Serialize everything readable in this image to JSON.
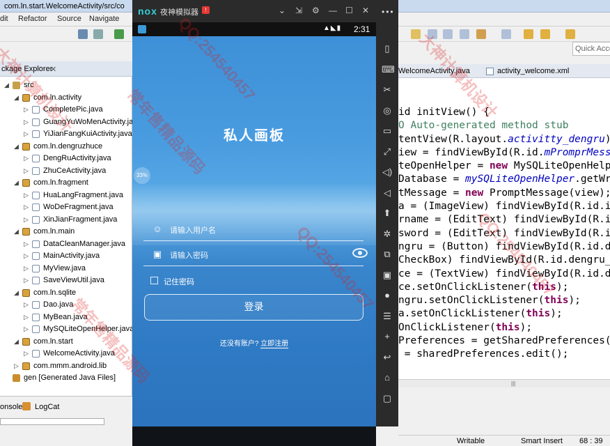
{
  "ide": {
    "title": "com.ln.start.WelcomeActivity/src/co",
    "menu": [
      "dit",
      "Refactor",
      "Source",
      "Navigate"
    ],
    "quick_access": "Quick Acce",
    "package_explorer_tab": "ckage Explorer",
    "tree": [
      {
        "label": "src",
        "type": "src",
        "level": 0,
        "arrow": "◢"
      },
      {
        "label": "com.ln.activity",
        "type": "pkg",
        "level": 1,
        "arrow": "◢"
      },
      {
        "label": "CompletePic.java",
        "type": "java",
        "level": 2,
        "arrow": "▷"
      },
      {
        "label": "GuangYuWoMenActivity.ja",
        "type": "java",
        "level": 2,
        "arrow": "▷"
      },
      {
        "label": "YiJianFangKuiActivity.java",
        "type": "java",
        "level": 2,
        "arrow": "▷"
      },
      {
        "label": "com.ln.dengruzhuce",
        "type": "pkg",
        "level": 1,
        "arrow": "◢"
      },
      {
        "label": "DengRuActivity.java",
        "type": "java",
        "level": 2,
        "arrow": "▷"
      },
      {
        "label": "ZhuCeActivity.java",
        "type": "java",
        "level": 2,
        "arrow": "▷"
      },
      {
        "label": "com.ln.fragment",
        "type": "pkg",
        "level": 1,
        "arrow": "◢"
      },
      {
        "label": "HuaLangFragment.java",
        "type": "java",
        "level": 2,
        "arrow": "▷"
      },
      {
        "label": "WoDeFragment.java",
        "type": "java",
        "level": 2,
        "arrow": "▷"
      },
      {
        "label": "XinJianFragment.java",
        "type": "java",
        "level": 2,
        "arrow": "▷"
      },
      {
        "label": "com.ln.main",
        "type": "pkg",
        "level": 1,
        "arrow": "◢"
      },
      {
        "label": "DataCleanManager.java",
        "type": "java",
        "level": 2,
        "arrow": "▷"
      },
      {
        "label": "MainActivity.java",
        "type": "java",
        "level": 2,
        "arrow": "▷"
      },
      {
        "label": "MyView.java",
        "type": "java",
        "level": 2,
        "arrow": "▷"
      },
      {
        "label": "SaveViewUtil.java",
        "type": "java",
        "level": 2,
        "arrow": "▷"
      },
      {
        "label": "com.ln.sqlite",
        "type": "pkg",
        "level": 1,
        "arrow": "◢"
      },
      {
        "label": "Dao.java",
        "type": "java",
        "level": 2,
        "arrow": "▷"
      },
      {
        "label": "MyBean.java",
        "type": "java",
        "level": 2,
        "arrow": "▷"
      },
      {
        "label": "MySQLiteOpenHelper.java",
        "type": "java",
        "level": 2,
        "arrow": "▷"
      },
      {
        "label": "com.ln.start",
        "type": "pkg",
        "level": 1,
        "arrow": "◢"
      },
      {
        "label": "WelcomeActivity.java",
        "type": "java",
        "level": 2,
        "arrow": "▷"
      },
      {
        "label": "com.mmm.android.lib",
        "type": "pkg",
        "level": 1,
        "arrow": "▷"
      },
      {
        "label": "gen [Generated Java Files]",
        "type": "gen",
        "level": 0,
        "arrow": ""
      }
    ],
    "bottom_tabs": [
      "onsole",
      "LogCat"
    ],
    "editor_tabs": [
      "WelcomeActivity.java",
      "activity_welcome.xml"
    ],
    "code_lines": [
      "id initView() {",
      "O Auto-generated method stub",
      "tentView(R.layout.activitty_dengru)",
      "iew = findViewById(R.id.mPromprMess",
      "teOpenHelper = new MySQLiteOpenHelp",
      "Database = mySQLiteOpenHelper.getWr",
      "tMessage = new PromptMessage(view);",
      "a = (ImageView) findViewById(R.id.i",
      "rname = (EditText) findViewById(R.i",
      "sword = (EditText) findViewById(R.i",
      "ngru = (Button) findViewById(R.id.d",
      "CheckBox) findViewById(R.id.dengru_",
      "ce = (TextView) findViewById(R.id.d",
      "ce.setOnClickListener(this);",
      "ngru.setOnClickListener(this);",
      "a.setOnClickListener(this);",
      "OnClickListener(this);",
      "Preferences = getSharedPreferences(",
      " = sharedPreferences.edit();"
    ],
    "status": {
      "writable": "Writable",
      "insert": "Smart Insert",
      "position": "68 : 39"
    }
  },
  "emulator": {
    "logo": "nox",
    "name": "夜神模拟器",
    "badge": "!",
    "controls": [
      "⌄",
      "⇲",
      "⚙",
      "—",
      "☐",
      "✕"
    ],
    "time": "2:31",
    "sidebar_icons": [
      "more-icon",
      "shake-icon",
      "keyboard-icon",
      "scissors-icon",
      "location-icon",
      "screen-icon",
      "fullscreen-icon",
      "volume-up-icon",
      "volume-down-icon",
      "apk-icon",
      "cpu-icon",
      "multi-window-icon",
      "camera-icon",
      "record-icon",
      "menu-icon",
      "add-icon",
      "back-icon",
      "home-icon",
      "recent-icon"
    ]
  },
  "app": {
    "title": "私人画板",
    "progress_badge": "33%",
    "username_placeholder": "请输入用户名",
    "password_placeholder": "请输入密码",
    "remember_label": "记住密码",
    "login_label": "登录",
    "register_prompt": "还没有账户?",
    "register_link": "立即注册"
  },
  "watermark": {
    "texts": [
      "QQ:254540457",
      "常年售精品源码",
      "大神计算机设计"
    ],
    "color": "#dc1e1e"
  }
}
